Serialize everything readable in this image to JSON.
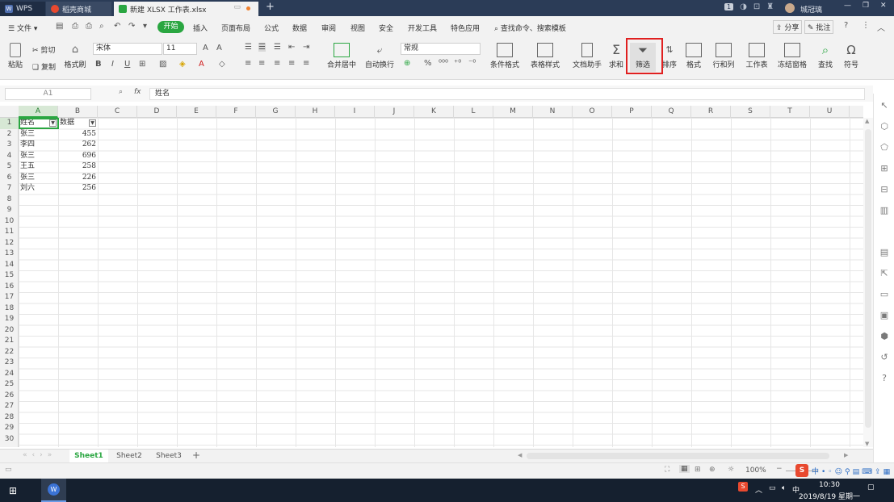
{
  "titlebar": {
    "tabs": [
      {
        "label": "WPS"
      },
      {
        "label": "稻壳商城"
      },
      {
        "label": "新建 XLSX 工作表.xlsx"
      }
    ],
    "user": "城冠璃",
    "page_badge": "1"
  },
  "menubar": {
    "file_label": "文件",
    "items": [
      "开始",
      "插入",
      "页面布局",
      "公式",
      "数据",
      "审阅",
      "视图",
      "安全",
      "开发工具",
      "特色应用"
    ],
    "search_label": "查找命令、搜索模板",
    "share_label": "分享",
    "comment_label": "批注"
  },
  "ribbon": {
    "paste": "粘贴",
    "cut": "剪切",
    "copy": "复制",
    "format_painter": "格式刷",
    "font_name": "宋体",
    "font_size": "11",
    "number_format": "常规",
    "merge": "合并居中",
    "wrap": "自动换行",
    "cond_format": "条件格式",
    "table_style": "表格样式",
    "doc_helper": "文档助手",
    "sum": "求和",
    "filter": "筛选",
    "sort": "排序",
    "format": "格式",
    "rowcol": "行和列",
    "worksheet": "工作表",
    "freeze": "冻结窗格",
    "find": "查找",
    "symbol": "符号"
  },
  "formula_bar": {
    "name_box": "A1",
    "fx": "fx",
    "content": "姓名"
  },
  "columns": [
    "A",
    "B",
    "C",
    "D",
    "E",
    "F",
    "G",
    "H",
    "I",
    "J",
    "K",
    "L",
    "M",
    "N",
    "O",
    "P",
    "Q",
    "R",
    "S",
    "T",
    "U"
  ],
  "rows": [
    "1",
    "2",
    "3",
    "4",
    "5",
    "6",
    "7",
    "8",
    "9",
    "10",
    "11",
    "12",
    "13",
    "14",
    "15",
    "16",
    "17",
    "18",
    "19",
    "20",
    "21",
    "22",
    "23",
    "24",
    "25",
    "26",
    "27",
    "28",
    "29",
    "30"
  ],
  "table": {
    "header": [
      "姓名",
      "数据"
    ],
    "rows": [
      [
        "张三",
        "455"
      ],
      [
        "李四",
        "262"
      ],
      [
        "张三",
        "696"
      ],
      [
        "王五",
        "258"
      ],
      [
        "张三",
        "226"
      ],
      [
        "刘六",
        "256"
      ]
    ]
  },
  "sheets": [
    "Sheet1",
    "Sheet2",
    "Sheet3"
  ],
  "status": {
    "zoom": "100%"
  },
  "taskbar": {
    "time": "10:30",
    "date": "2019/8/19 星期一"
  }
}
